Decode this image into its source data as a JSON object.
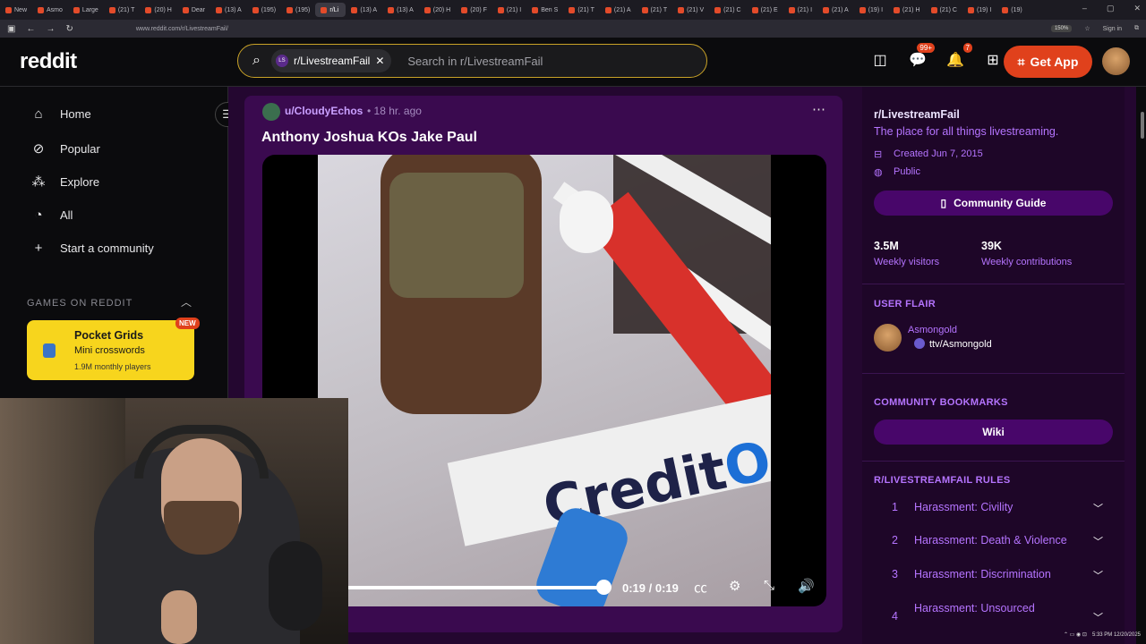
{
  "browser": {
    "tabs": [
      "New",
      "Asmo",
      "Large",
      "(21) T",
      "(20) H",
      "Dear",
      "(13) A",
      "(195)",
      "(195)",
      "r/Li",
      "(13) A",
      "(13) A",
      "(20) H",
      "(20) F",
      "(21) I",
      "Ben S",
      "(21) T",
      "(21) A",
      "(21) T",
      "(21) V",
      "(21) C",
      "(21) E",
      "(21) I",
      "(21) A",
      "(19) I",
      "(21) H",
      "(21) C",
      "(19) I",
      "(19)"
    ],
    "active_tab_index": 9,
    "url": "www.reddit.com/r/LivestreamFail/",
    "zoom": "150%",
    "signin": "Sign in"
  },
  "header": {
    "logo": "reddit",
    "search_chip": "r/LivestreamFail",
    "search_chip_icon": "LS",
    "search_placeholder": "Search in r/LivestreamFail",
    "chat_badge": "99+",
    "notif_badge": "7",
    "get_app": "Get App"
  },
  "leftnav": {
    "items": [
      {
        "label": "Home",
        "icon": "home-icon"
      },
      {
        "label": "Popular",
        "icon": "popular-icon"
      },
      {
        "label": "Explore",
        "icon": "explore-icon"
      },
      {
        "label": "All",
        "icon": "all-icon"
      },
      {
        "label": "Start a community",
        "icon": "plus-icon"
      }
    ],
    "games_heading": "GAMES ON REDDIT",
    "game": {
      "title": "Pocket Grids",
      "subtitle": "Mini crosswords",
      "meta": "1.9M monthly players",
      "badge": "NEW"
    }
  },
  "post": {
    "user": "u/CloudyEchos",
    "time": "18 hr. ago",
    "title": "Anthony Joshua KOs Jake Paul",
    "video_overlay_text": "CreditOr",
    "video_time": "0:19 / 0:19",
    "progress": 1.0
  },
  "sidebar": {
    "name": "r/LivestreamFail",
    "description": "The place for all things livestreaming.",
    "created": "Created Jun 7, 2015",
    "visibility": "Public",
    "guide_button": "Community Guide",
    "stats": [
      {
        "value": "3.5M",
        "label": "Weekly visitors"
      },
      {
        "value": "39K",
        "label": "Weekly contributions"
      }
    ],
    "flair_heading": "USER FLAIR",
    "flair_name": "Asmongold",
    "flair_tag": "ttv/Asmongold",
    "bookmarks_heading": "COMMUNITY BOOKMARKS",
    "wiki_button": "Wiki",
    "rules_heading": "R/LIVESTREAMFAIL RULES",
    "rules": [
      {
        "num": "1",
        "label": "Harassment: Civility"
      },
      {
        "num": "2",
        "label": "Harassment: Death & Violence"
      },
      {
        "num": "3",
        "label": "Harassment: Discrimination"
      },
      {
        "num": "4",
        "label": "Harassment: Unsourced"
      }
    ]
  },
  "colors": {
    "accent": "#b574ff",
    "brand_orange": "#e0411c",
    "panel_bg": "#240730",
    "post_bg": "#3a0a4f"
  },
  "taskbar": {
    "time": "5:33 PM",
    "date": "12/20/2025"
  }
}
